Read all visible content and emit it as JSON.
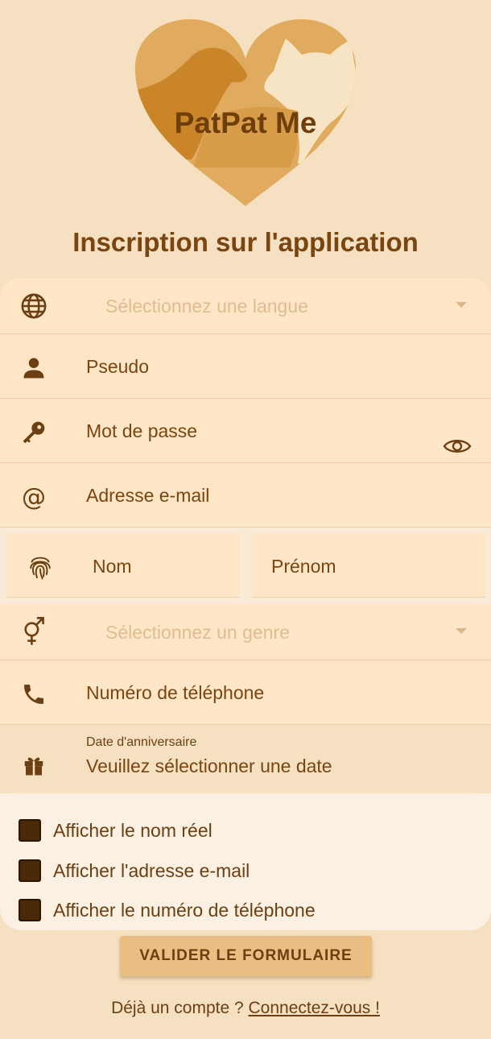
{
  "app": {
    "logo_text": "PatPat Me"
  },
  "page": {
    "title": "Inscription sur l'application"
  },
  "form": {
    "language": {
      "placeholder": "Sélectionnez une langue",
      "icon": "globe-icon"
    },
    "pseudo": {
      "placeholder": "Pseudo",
      "icon": "person-icon"
    },
    "password": {
      "placeholder": "Mot de passe",
      "icon": "key-icon",
      "toggle_icon": "eye-icon"
    },
    "email": {
      "placeholder": "Adresse e-mail",
      "icon": "at-icon"
    },
    "last_name": {
      "placeholder": "Nom",
      "icon": "fingerprint-icon"
    },
    "first_name": {
      "placeholder": "Prénom"
    },
    "gender": {
      "placeholder": "Sélectionnez un genre",
      "icon": "gender-icon"
    },
    "phone": {
      "placeholder": "Numéro de téléphone",
      "icon": "phone-icon"
    },
    "birthday": {
      "label": "Date d'anniversaire",
      "value": "Veuillez sélectionner une date",
      "icon": "gift-icon"
    }
  },
  "options": {
    "show_real_name": {
      "label": "Afficher le nom réel",
      "checked": false
    },
    "show_email": {
      "label": "Afficher l'adresse e-mail",
      "checked": false
    },
    "show_phone": {
      "label": "Afficher le numéro de téléphone",
      "checked": false
    }
  },
  "actions": {
    "submit_label": "VALIDER LE FORMULAIRE"
  },
  "footer": {
    "prompt": "Déjà un compte ?",
    "link": "Connectez-vous !"
  },
  "colors": {
    "background": "#f5e0c1",
    "field": "#fee6c6",
    "text": "#7a4511",
    "button": "#e8be83",
    "checkbox": "#4a2908"
  }
}
